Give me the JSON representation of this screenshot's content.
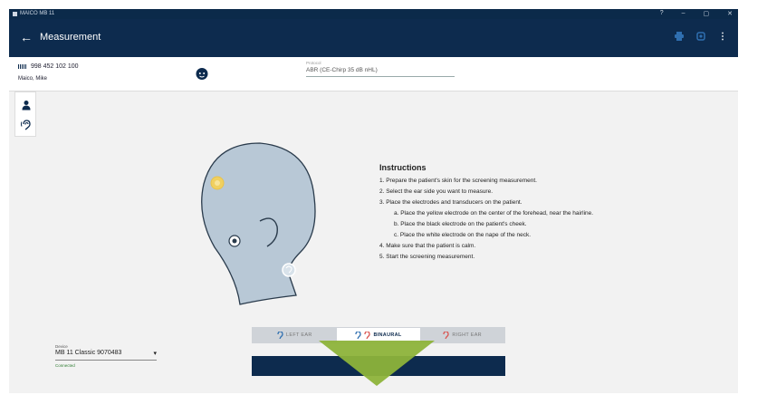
{
  "window": {
    "app_title": "MAICO MB 11",
    "controls": [
      "?",
      "–",
      "▢",
      "✕"
    ]
  },
  "appbar": {
    "title": "Measurement",
    "back_icon": "arrow-left-icon",
    "actions": [
      "print-icon",
      "export-icon",
      "more-vert-icon"
    ]
  },
  "patient": {
    "id": "998 452 102 100",
    "name": "Maico, Mike"
  },
  "protocol": {
    "label": "Protocol",
    "value": "ABR (CE-Chirp 35 dB nHL)"
  },
  "sidebar": {
    "tools": [
      "person-icon",
      "ear-icon"
    ]
  },
  "instructions": {
    "title": "Instructions",
    "items": [
      "1. Prepare the patient's skin for the screening measurement.",
      "2. Select the ear side you want to measure.",
      "3. Place the electrodes and transducers on the patient.",
      "a. Place the yellow electrode on the center of the forehead, near the hairline.",
      "b. Place the black electrode on the patient's cheek.",
      "c. Place the white electrode on the nape of the neck.",
      "4. Make sure that the patient is calm.",
      "5. Start the screening measurement."
    ]
  },
  "ear_select": {
    "options": [
      {
        "label": "LEFT EAR",
        "active": false
      },
      {
        "label": "BINAURAL",
        "active": true
      },
      {
        "label": "RIGHT EAR",
        "active": false
      }
    ]
  },
  "device": {
    "label": "Device",
    "value": "MB 11 Classic 9070483",
    "status": "Connected"
  },
  "colors": {
    "primary": "#0d2b4e",
    "accent_arrow": "#8db33a",
    "head_fill": "#b8c8d6",
    "yellow_electrode": "#f0d060",
    "left_ear": "#2f6fb0",
    "right_ear": "#d9534f",
    "connected": "#2e7d32"
  }
}
